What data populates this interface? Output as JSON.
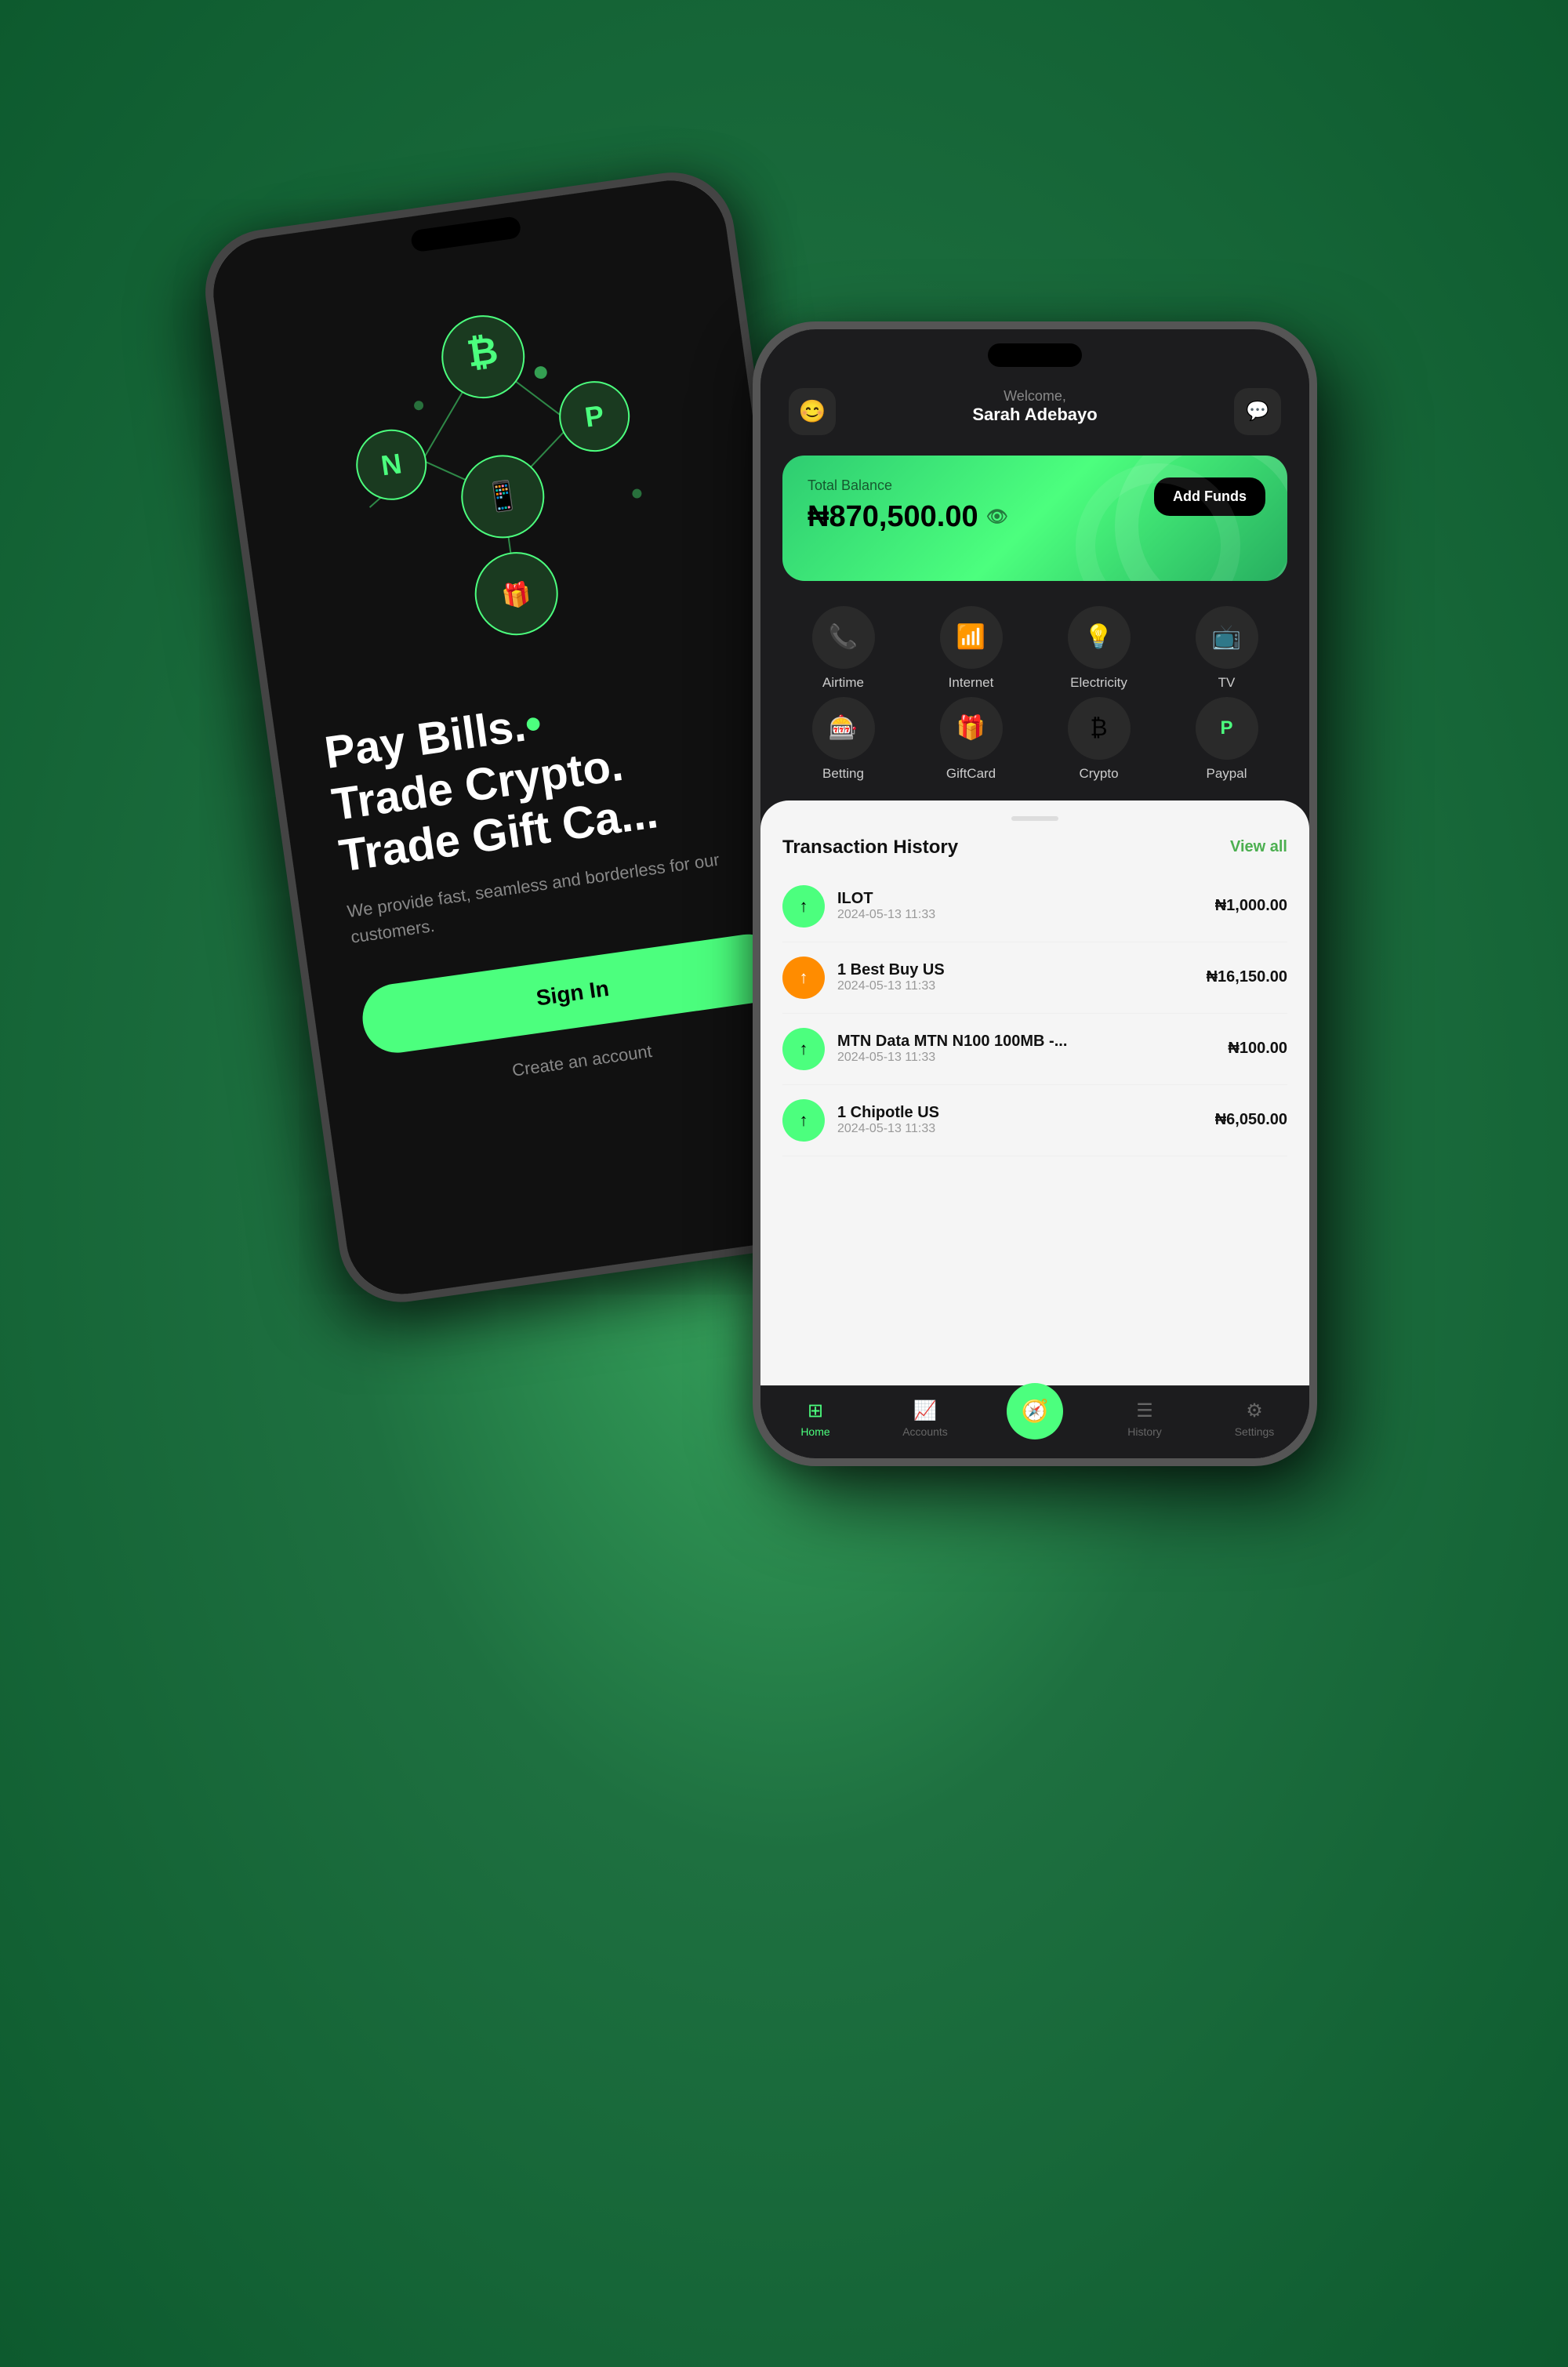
{
  "back_phone": {
    "headline_line1": "Pay Bills.",
    "headline_line2": "Trade Crypto.",
    "headline_line3": "Trade Gift Ca...",
    "subtext": "We provide fast, seamless and borderless for our customers.",
    "signin_label": "Sign In",
    "create_account_label": "Create an account"
  },
  "front_phone": {
    "welcome_label": "Welcome,",
    "user_name": "Sarah Adebayo",
    "balance_label": "Total Balance",
    "balance_amount": "₦870,500.00",
    "add_funds_label": "Add Funds",
    "actions": [
      {
        "id": "airtime",
        "label": "Airtime",
        "icon": "📞"
      },
      {
        "id": "internet",
        "label": "Internet",
        "icon": "📶"
      },
      {
        "id": "electricity",
        "label": "Electricity",
        "icon": "💡"
      },
      {
        "id": "tv",
        "label": "TV",
        "icon": "📺"
      },
      {
        "id": "betting",
        "label": "Betting",
        "icon": "🎰"
      },
      {
        "id": "giftcard",
        "label": "GiftCard",
        "icon": "🎁"
      },
      {
        "id": "crypto",
        "label": "Crypto",
        "icon": "₿"
      },
      {
        "id": "paypal",
        "label": "Paypal",
        "icon": "🅿"
      }
    ],
    "transaction_title": "Transaction History",
    "view_all_label": "View all",
    "transactions": [
      {
        "id": "t1",
        "name": "ILOT",
        "date": "2024-05-13 11:33",
        "amount": "₦1,000.00",
        "icon": "↑",
        "icon_type": "green"
      },
      {
        "id": "t2",
        "name": "1 Best Buy US",
        "date": "2024-05-13 11:33",
        "amount": "₦16,150.00",
        "icon": "↑",
        "icon_type": "orange"
      },
      {
        "id": "t3",
        "name": "MTN Data MTN N100 100MB -...",
        "date": "2024-05-13 11:33",
        "amount": "₦100.00",
        "icon": "↑",
        "icon_type": "green"
      },
      {
        "id": "t4",
        "name": "1 Chipotle US",
        "date": "2024-05-13 11:33",
        "amount": "₦6,050.00",
        "icon": "↑",
        "icon_type": "green"
      }
    ],
    "bottom_nav": [
      {
        "id": "home",
        "label": "Home",
        "icon": "⊞",
        "active": true
      },
      {
        "id": "accounts",
        "label": "Accounts",
        "icon": "📈",
        "active": false
      },
      {
        "id": "compass",
        "label": "",
        "icon": "🧭",
        "active": false,
        "center": true
      },
      {
        "id": "history",
        "label": "History",
        "icon": "☰",
        "active": false
      },
      {
        "id": "settings",
        "label": "Settings",
        "icon": "⚙",
        "active": false
      }
    ]
  }
}
